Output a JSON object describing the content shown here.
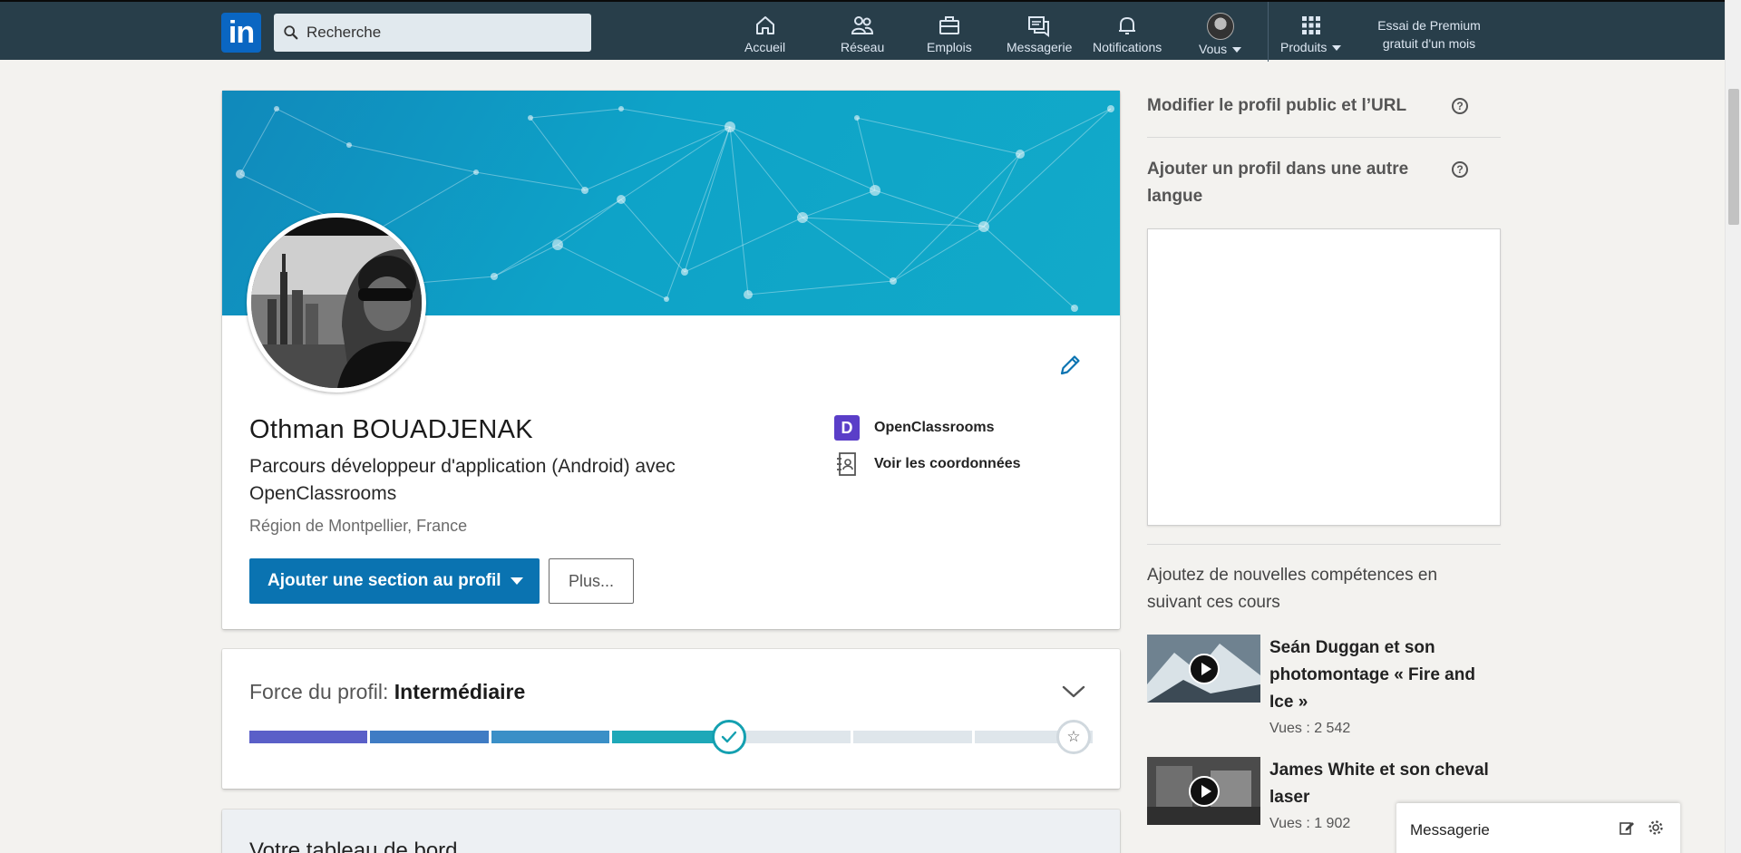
{
  "nav": {
    "search_placeholder": "Recherche",
    "items": [
      {
        "label": "Accueil",
        "icon": "home-icon"
      },
      {
        "label": "Réseau",
        "icon": "network-icon"
      },
      {
        "label": "Emplois",
        "icon": "jobs-icon"
      },
      {
        "label": "Messagerie",
        "icon": "messaging-icon"
      },
      {
        "label": "Notifications",
        "icon": "bell-icon"
      },
      {
        "label": "Vous",
        "icon": "avatar"
      },
      {
        "label": "Produits",
        "icon": "grid-icon"
      }
    ],
    "premium": "Essai de Premium gratuit d'un mois",
    "logo_text": "in"
  },
  "profile": {
    "name": "Othman BOUADJENAK",
    "headline": "Parcours développeur d'application (Android) avec OpenClassrooms",
    "location": "Région de Montpellier, France",
    "add_section_button": "Ajouter une section au profil",
    "more_button": "Plus...",
    "company": "OpenClassrooms",
    "company_logo_letter": "D",
    "contact_link": "Voir les coordonnées"
  },
  "strength": {
    "label": "Force du profil:",
    "level": "Intermédiaire",
    "progress_fraction": 0.58
  },
  "dashboard": {
    "title": "Votre tableau de bord"
  },
  "rail": {
    "public_profile": "Modifier le profil public et l’URL",
    "other_language": "Ajouter un profil dans une autre langue",
    "help_glyph": "?",
    "courses_title": "Ajoutez de nouvelles compétences en suivant ces cours",
    "courses": [
      {
        "title": "Seán Duggan et son photomontage « Fire and Ice »",
        "views": "Vues : 2 542"
      },
      {
        "title": "James White et son cheval laser",
        "views": "Vues : 1 902"
      }
    ]
  },
  "messaging": {
    "label": "Messagerie"
  },
  "colors": {
    "nav_bg": "#283e4a",
    "primary": "#0a73b1",
    "meter": [
      "#5a5fc8",
      "#3f7cc4",
      "#3a8fc7",
      "#1ea8b8",
      "#23a783"
    ]
  }
}
